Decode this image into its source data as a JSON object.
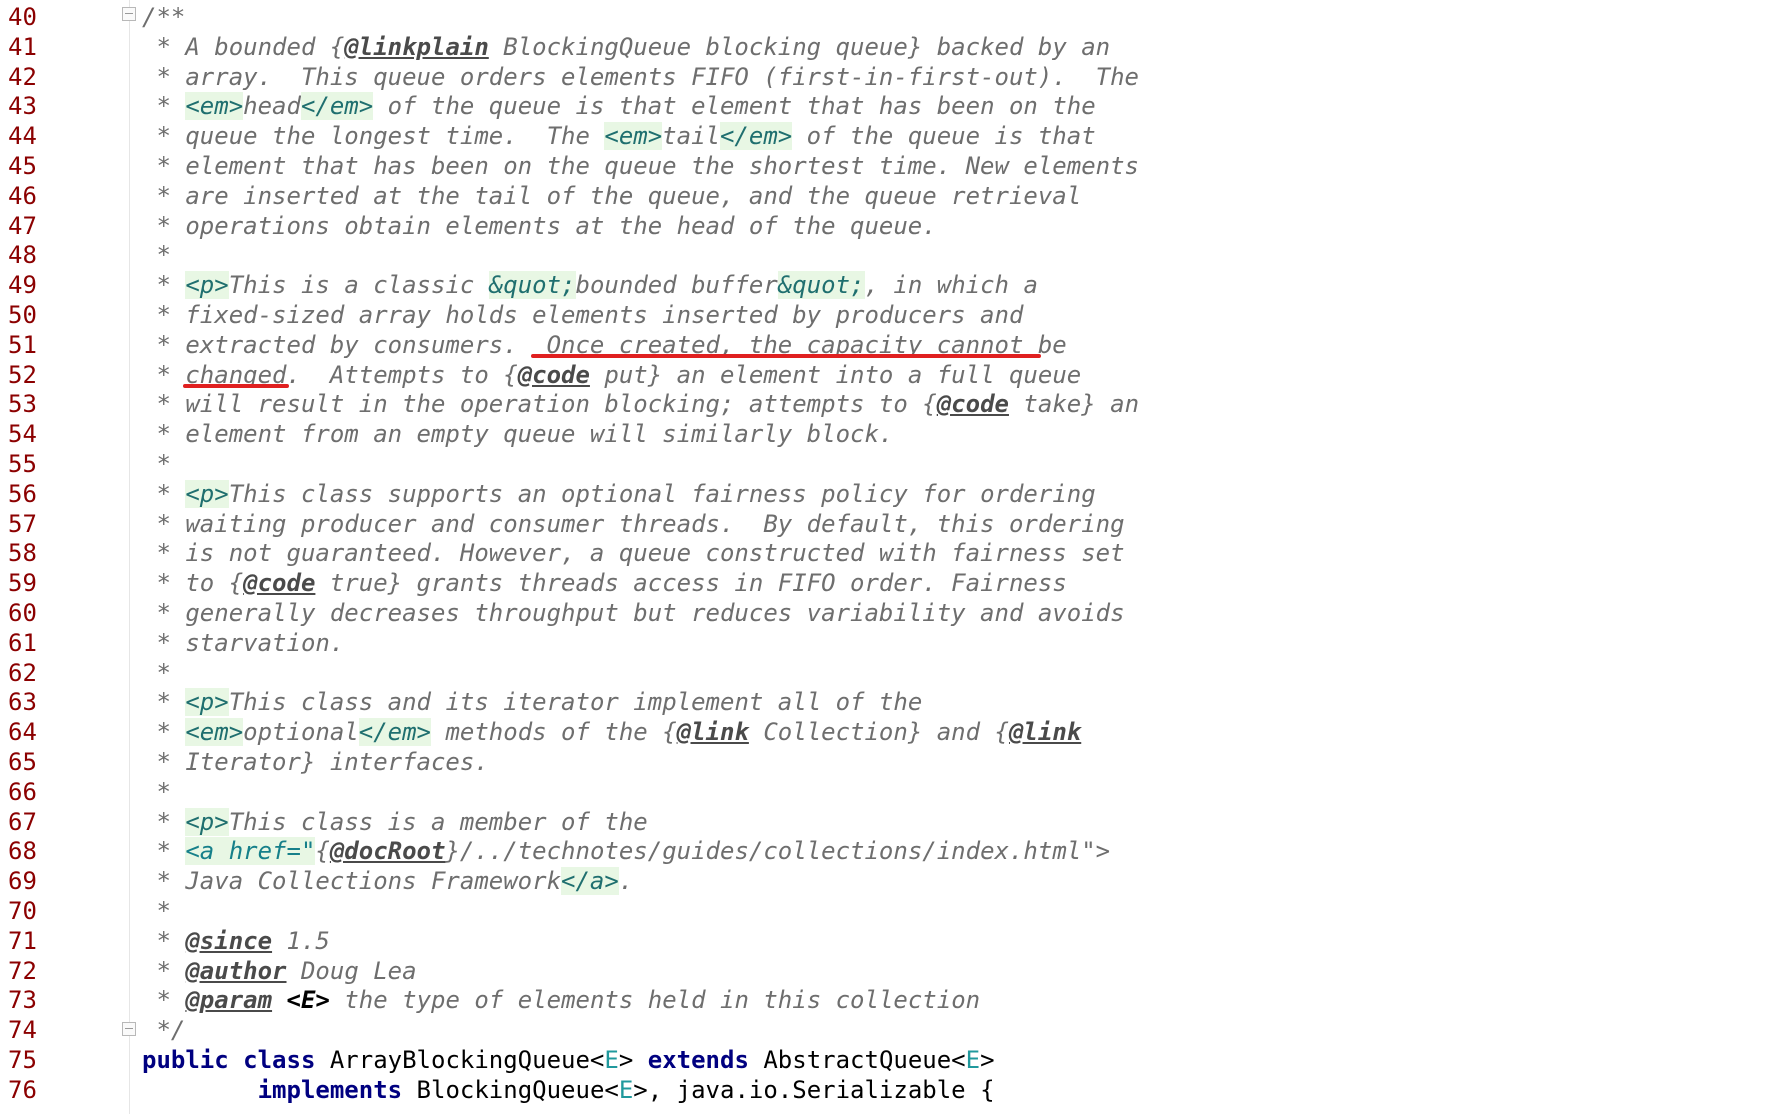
{
  "editor": {
    "lines": [
      {
        "n": "40",
        "segments": [
          {
            "t": "/**",
            "c": "c"
          }
        ]
      },
      {
        "n": "41",
        "segments": [
          {
            "t": " * A bounded {",
            "c": "c"
          },
          {
            "t": "@linkplain",
            "c": "jd"
          },
          {
            "t": " BlockingQueue blocking queue} backed by an",
            "c": "c"
          }
        ]
      },
      {
        "n": "42",
        "segments": [
          {
            "t": " * array.  This queue orders elements FIFO (first-in-first-out).  The",
            "c": "c"
          }
        ]
      },
      {
        "n": "43",
        "segments": [
          {
            "t": " * ",
            "c": "c"
          },
          {
            "t": "<em>",
            "c": "tag"
          },
          {
            "t": "head",
            "c": "c"
          },
          {
            "t": "</em>",
            "c": "tag"
          },
          {
            "t": " of the queue is that element that has been on the",
            "c": "c"
          }
        ]
      },
      {
        "n": "44",
        "segments": [
          {
            "t": " * queue the longest time.  The ",
            "c": "c"
          },
          {
            "t": "<em>",
            "c": "tag"
          },
          {
            "t": "tail",
            "c": "c"
          },
          {
            "t": "</em>",
            "c": "tag"
          },
          {
            "t": " of the queue is that",
            "c": "c"
          }
        ]
      },
      {
        "n": "45",
        "segments": [
          {
            "t": " * element that has been on the queue the shortest time. New elements",
            "c": "c"
          }
        ]
      },
      {
        "n": "46",
        "segments": [
          {
            "t": " * are inserted at the tail of the queue, and the queue retrieval",
            "c": "c"
          }
        ]
      },
      {
        "n": "47",
        "segments": [
          {
            "t": " * operations obtain elements at the head of the queue.",
            "c": "c"
          }
        ]
      },
      {
        "n": "48",
        "segments": [
          {
            "t": " *",
            "c": "c"
          }
        ]
      },
      {
        "n": "49",
        "segments": [
          {
            "t": " * ",
            "c": "c"
          },
          {
            "t": "<p>",
            "c": "tag"
          },
          {
            "t": "This is a classic ",
            "c": "c"
          },
          {
            "t": "&quot;",
            "c": "tag"
          },
          {
            "t": "bounded buffer",
            "c": "c"
          },
          {
            "t": "&quot;",
            "c": "tag"
          },
          {
            "t": ", in which a",
            "c": "c"
          }
        ]
      },
      {
        "n": "50",
        "segments": [
          {
            "t": " * fixed-sized array holds elements inserted by producers and",
            "c": "c"
          }
        ]
      },
      {
        "n": "51",
        "segments": [
          {
            "t": " * extracted by consumers.  Once created, the capacity cannot be",
            "c": "c"
          }
        ]
      },
      {
        "n": "52",
        "segments": [
          {
            "t": " * changed.  Attempts to {",
            "c": "c"
          },
          {
            "t": "@code",
            "c": "jd"
          },
          {
            "t": " put} an element into a full queue",
            "c": "c"
          }
        ]
      },
      {
        "n": "53",
        "segments": [
          {
            "t": " * will result in the operation blocking; attempts to {",
            "c": "c"
          },
          {
            "t": "@code",
            "c": "jd"
          },
          {
            "t": " take} an",
            "c": "c"
          }
        ]
      },
      {
        "n": "54",
        "segments": [
          {
            "t": " * element from an empty queue will similarly block.",
            "c": "c"
          }
        ]
      },
      {
        "n": "55",
        "segments": [
          {
            "t": " *",
            "c": "c"
          }
        ]
      },
      {
        "n": "56",
        "segments": [
          {
            "t": " * ",
            "c": "c"
          },
          {
            "t": "<p>",
            "c": "tag"
          },
          {
            "t": "This class supports an optional fairness policy for ordering",
            "c": "c"
          }
        ]
      },
      {
        "n": "57",
        "segments": [
          {
            "t": " * waiting producer and consumer threads.  By default, this ordering",
            "c": "c"
          }
        ]
      },
      {
        "n": "58",
        "segments": [
          {
            "t": " * is not guaranteed. However, a queue constructed with fairness set",
            "c": "c"
          }
        ]
      },
      {
        "n": "59",
        "segments": [
          {
            "t": " * to {",
            "c": "c"
          },
          {
            "t": "@code",
            "c": "jd"
          },
          {
            "t": " true} grants threads access in FIFO order. Fairness",
            "c": "c"
          }
        ]
      },
      {
        "n": "60",
        "segments": [
          {
            "t": " * generally decreases throughput but reduces variability and avoids",
            "c": "c"
          }
        ]
      },
      {
        "n": "61",
        "segments": [
          {
            "t": " * starvation.",
            "c": "c"
          }
        ]
      },
      {
        "n": "62",
        "segments": [
          {
            "t": " *",
            "c": "c"
          }
        ]
      },
      {
        "n": "63",
        "segments": [
          {
            "t": " * ",
            "c": "c"
          },
          {
            "t": "<p>",
            "c": "tag"
          },
          {
            "t": "This class and its iterator implement all of the",
            "c": "c"
          }
        ]
      },
      {
        "n": "64",
        "segments": [
          {
            "t": " * ",
            "c": "c"
          },
          {
            "t": "<em>",
            "c": "tag"
          },
          {
            "t": "optional",
            "c": "c"
          },
          {
            "t": "</em>",
            "c": "tag"
          },
          {
            "t": " methods of the {",
            "c": "c"
          },
          {
            "t": "@link",
            "c": "jd"
          },
          {
            "t": " Collection} and {",
            "c": "c"
          },
          {
            "t": "@link",
            "c": "jd"
          }
        ]
      },
      {
        "n": "65",
        "segments": [
          {
            "t": " * Iterator} interfaces.",
            "c": "c"
          }
        ]
      },
      {
        "n": "66",
        "segments": [
          {
            "t": " *",
            "c": "c"
          }
        ]
      },
      {
        "n": "67",
        "segments": [
          {
            "t": " * ",
            "c": "c"
          },
          {
            "t": "<p>",
            "c": "tag"
          },
          {
            "t": "This class is a member of the",
            "c": "c"
          }
        ]
      },
      {
        "n": "68",
        "segments": [
          {
            "t": " * ",
            "c": "c"
          },
          {
            "t": "<a href=\"",
            "c": "tagkw"
          },
          {
            "t": "{",
            "c": "c"
          },
          {
            "t": "@docRoot",
            "c": "jd"
          },
          {
            "t": "}/../technotes/guides/collections/index.html\">",
            "c": "c"
          }
        ]
      },
      {
        "n": "69",
        "segments": [
          {
            "t": " * Java Collections Framework",
            "c": "c"
          },
          {
            "t": "</a>",
            "c": "tag"
          },
          {
            "t": ".",
            "c": "c"
          }
        ]
      },
      {
        "n": "70",
        "segments": [
          {
            "t": " *",
            "c": "c"
          }
        ]
      },
      {
        "n": "71",
        "segments": [
          {
            "t": " * ",
            "c": "c"
          },
          {
            "t": "@since",
            "c": "jd"
          },
          {
            "t": " 1.5",
            "c": "c"
          }
        ]
      },
      {
        "n": "72",
        "segments": [
          {
            "t": " * ",
            "c": "c"
          },
          {
            "t": "@author",
            "c": "jd"
          },
          {
            "t": " Doug Lea",
            "c": "c"
          }
        ]
      },
      {
        "n": "73",
        "segments": [
          {
            "t": " * ",
            "c": "c"
          },
          {
            "t": "@param",
            "c": "jd"
          },
          {
            "t": " ",
            "c": "c"
          },
          {
            "t": "<E>",
            "c": "param"
          },
          {
            "t": " the type of elements held in this collection",
            "c": "c"
          }
        ]
      },
      {
        "n": "74",
        "segments": [
          {
            "t": " */",
            "c": "c"
          }
        ]
      },
      {
        "n": "75",
        "segments": [
          {
            "t": "public class ",
            "c": "kw"
          },
          {
            "t": "ArrayBlockingQueue<",
            "c": "plain"
          },
          {
            "t": "E",
            "c": "generic"
          },
          {
            "t": "> ",
            "c": "plain"
          },
          {
            "t": "extends ",
            "c": "kw"
          },
          {
            "t": "AbstractQueue<",
            "c": "plain"
          },
          {
            "t": "E",
            "c": "generic"
          },
          {
            "t": ">",
            "c": "plain"
          }
        ]
      },
      {
        "n": "76",
        "segments": [
          {
            "t": "        ",
            "c": "plain"
          },
          {
            "t": "implements ",
            "c": "kw"
          },
          {
            "t": "BlockingQueue<",
            "c": "plain"
          },
          {
            "t": "E",
            "c": "generic"
          },
          {
            "t": ">, java.io.Serializable {",
            "c": "plain"
          }
        ]
      }
    ],
    "colors": {
      "line_number": "#8b0000",
      "comment": "#6e6e6e",
      "tag_bg": "#e8f7e4",
      "keyword": "#000080",
      "annotation_red": "#e02020"
    }
  }
}
